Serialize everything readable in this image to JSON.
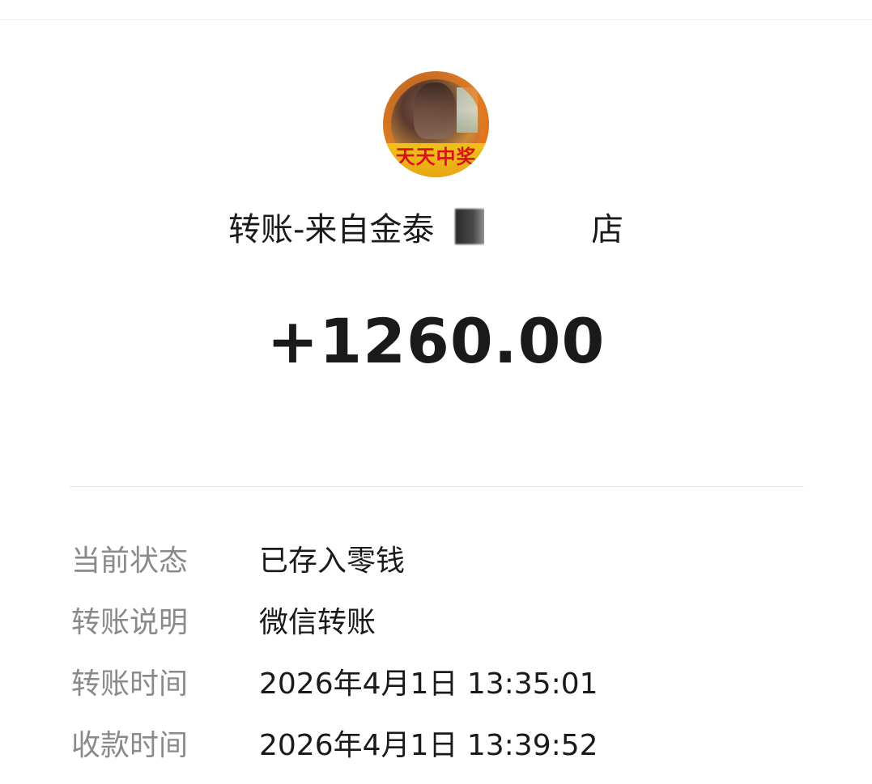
{
  "header": {
    "title_left": "转账-来自金泰",
    "title_right": "店"
  },
  "avatar": {
    "banner_text": "天天中奖"
  },
  "amount": "+1260.00",
  "details": [
    {
      "label": "当前状态",
      "value": "已存入零钱"
    },
    {
      "label": "转账说明",
      "value": "微信转账"
    },
    {
      "label": "转账时间",
      "value": "2026年4月1日 13:35:01"
    },
    {
      "label": "收款时间",
      "value": "2026年4月1日 13:39:52"
    }
  ],
  "colors": {
    "text_primary": "#1a1a1a",
    "text_label": "#8a8a8a",
    "divider": "#e6e6e6"
  }
}
